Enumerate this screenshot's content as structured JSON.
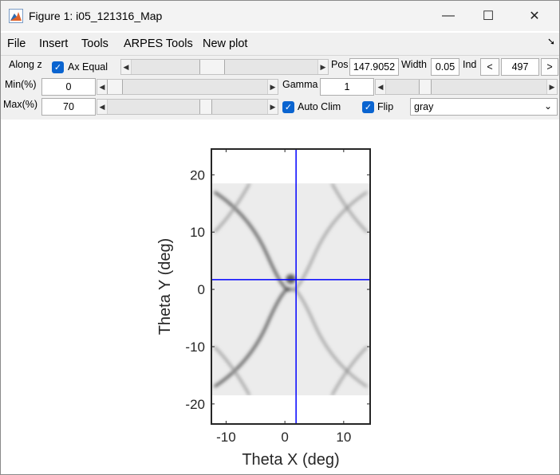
{
  "window": {
    "title": "Figure 1: i05_121316_Map",
    "minimize_glyph": "—",
    "maximize_glyph": "☐",
    "close_glyph": "✕"
  },
  "menu": {
    "items": [
      "File",
      "Insert",
      "Tools",
      "ARPES Tools",
      "New plot"
    ],
    "dock_glyph": "➘"
  },
  "controls": {
    "along_label": "Along z",
    "ax_equal_label": "Ax Equal",
    "ax_equal_checked": true,
    "pos_label": "Pos",
    "pos_value": "147.9052",
    "width_label": "Width",
    "width_value": "0.05",
    "ind_label": "Ind",
    "ind_prev": "<",
    "ind_value": "497",
    "ind_next": ">",
    "min_label": "Min(%)",
    "min_value": "0",
    "max_label": "Max(%)",
    "max_value": "70",
    "gamma_label": "Gamma",
    "gamma_value": "1",
    "auto_clim_label": "Auto Clim",
    "auto_clim_checked": true,
    "flip_label": "Flip",
    "flip_checked": true,
    "colormap_value": "gray",
    "slider_levels": {
      "along": 0.45,
      "min": 0.0,
      "max": 0.6,
      "gamma": 0.2
    }
  },
  "chart_data": {
    "type": "heatmap",
    "xlabel": "Theta X (deg)",
    "ylabel": "Theta Y (deg)",
    "xlim": [
      -12.5,
      14.5
    ],
    "ylim": [
      -23.5,
      24.5
    ],
    "data_ylim": [
      -18.5,
      18.5
    ],
    "xticks": [
      -10,
      0,
      10
    ],
    "xtick_labels": [
      "-10",
      "0",
      "10"
    ],
    "yticks": [
      -20,
      -10,
      0,
      10,
      20
    ],
    "ytick_labels": [
      "-20",
      "-10",
      "0",
      "10",
      "20"
    ],
    "crosshair": {
      "x": 1.9,
      "y": 1.7,
      "color": "#0000ff"
    },
    "colormap": "gray (flipped)"
  }
}
